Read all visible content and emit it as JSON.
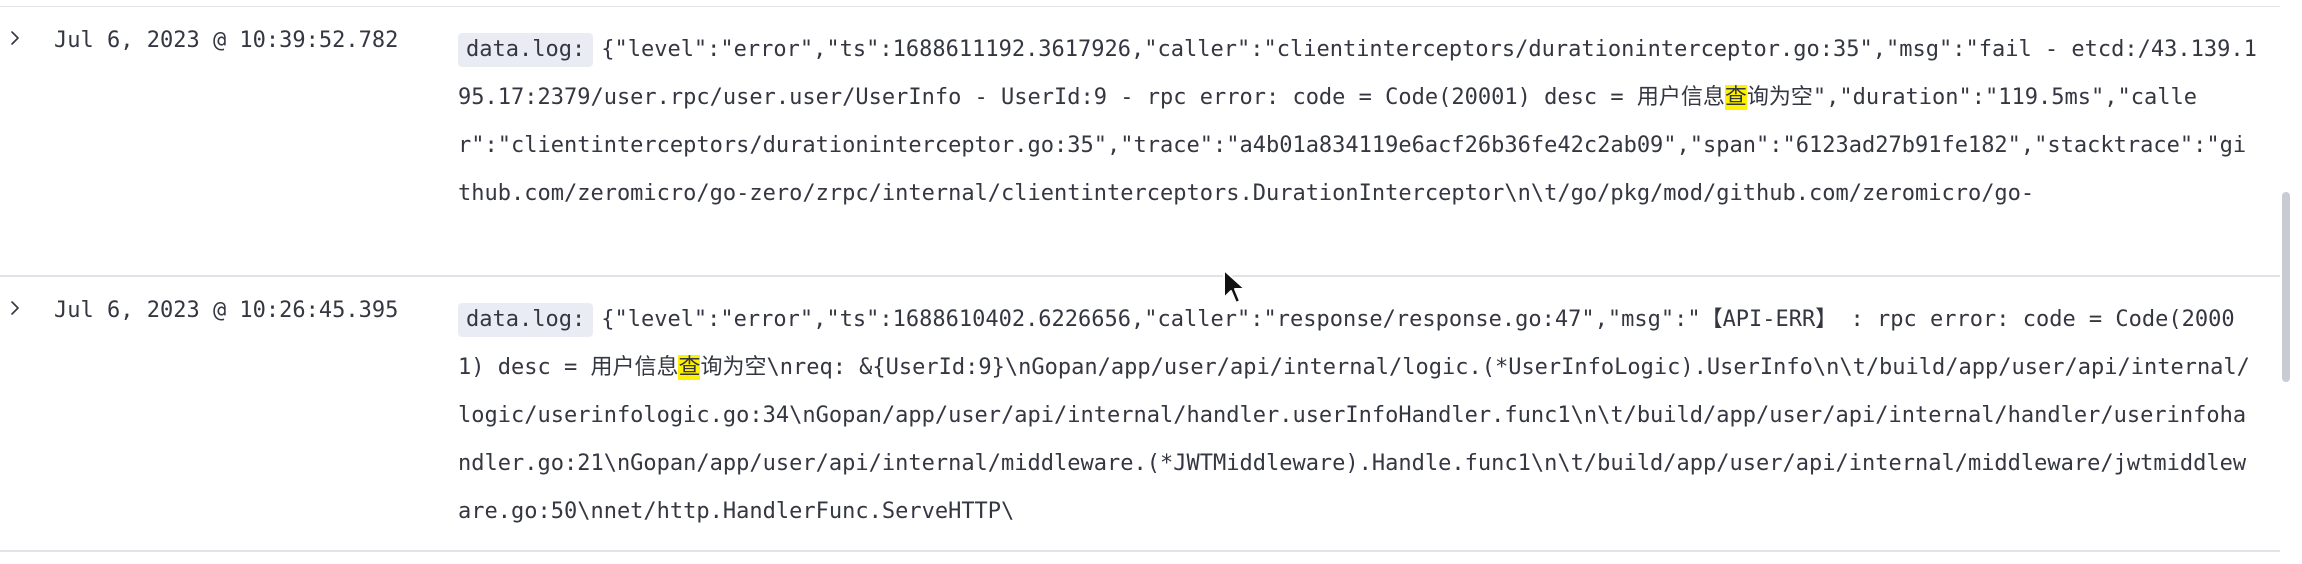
{
  "rows": [
    {
      "timestamp": "Jul 6, 2023 @ 10:39:52.782",
      "field_label": "data.log:",
      "msg_before": "{\"level\":\"error\",\"ts\":1688611192.3617926,\"caller\":\"clientinterceptors/durationinterceptor.go:35\",\"msg\":\"fail - etcd:/43.139.195.17:2379/user.rpc/user.user/UserInfo - UserId:9 - rpc error: code = Code(20001) desc = 用户信息",
      "highlight": "查",
      "msg_after": "询为空\",\"duration\":\"119.5ms\",\"caller\":\"clientinterceptors/durationinterceptor.go:35\",\"trace\":\"a4b01a834119e6acf26b36fe42c2ab09\",\"span\":\"6123ad27b91fe182\",\"stacktrace\":\"github.com/zeromicro/go-zero/zrpc/internal/clientinterceptors.DurationInterceptor\\n\\t/go/pkg/mod/github.com/zeromicro/go-"
    },
    {
      "timestamp": "Jul 6, 2023 @ 10:26:45.395",
      "field_label": "data.log:",
      "msg_before": "{\"level\":\"error\",\"ts\":1688610402.6226656,\"caller\":\"response/response.go:47\",\"msg\":\"【API-ERR】 : rpc error: code = Code(20001) desc = 用户信息",
      "highlight": "查",
      "msg_after": "询为空\\nreq: &{UserId:9}\\nGopan/app/user/api/internal/logic.(*UserInfoLogic).UserInfo\\n\\t/build/app/user/api/internal/logic/userinfologic.go:34\\nGopan/app/user/api/internal/handler.userInfoHandler.func1\\n\\t/build/app/user/api/internal/handler/userinfohandler.go:21\\nGopan/app/user/api/internal/middleware.(*JWTMiddleware).Handle.func1\\n\\t/build/app/user/api/internal/middleware/jwtmiddleware.go:50\\nnet/http.HandlerFunc.ServeHTTP\\"
    }
  ],
  "icons": {
    "expand": "chevron-right-icon",
    "cursor": "mouse-pointer-icon"
  },
  "colors": {
    "highlight": "#fff200",
    "badge_bg": "#e9edf3",
    "divider": "#e0e3e8",
    "text": "#343741"
  }
}
